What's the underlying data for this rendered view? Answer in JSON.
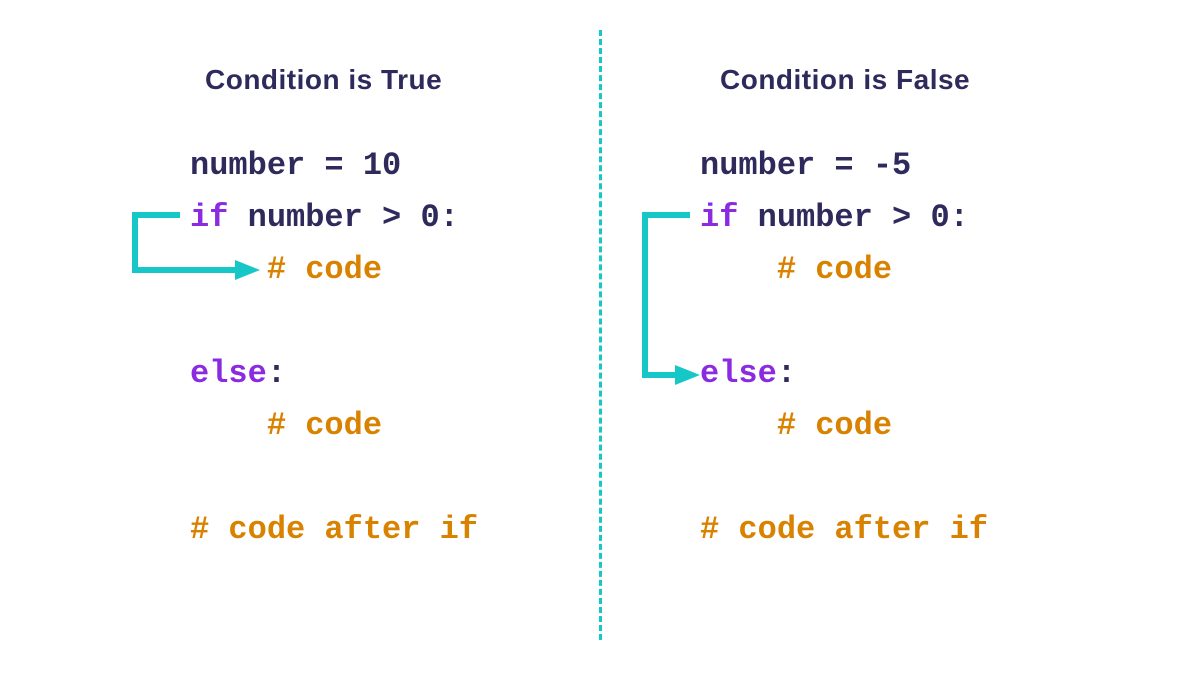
{
  "left": {
    "heading": "Condition is True",
    "line1_number": "number",
    "line1_eq": " = ",
    "line1_val": "10",
    "line2_if": "if",
    "line2_rest": " number > 0:",
    "line3": "    # code",
    "line5_else": "else",
    "line5_colon": ":",
    "line6": "    # code",
    "line8": "# code after if"
  },
  "right": {
    "heading": "Condition is False",
    "line1_number": "number",
    "line1_eq": " = ",
    "line1_val": "-5",
    "line2_if": "if",
    "line2_rest": " number > 0:",
    "line3": "    # code",
    "line5_else": "else",
    "line5_colon": ":",
    "line6": "    # code",
    "line8": "# code after if"
  }
}
